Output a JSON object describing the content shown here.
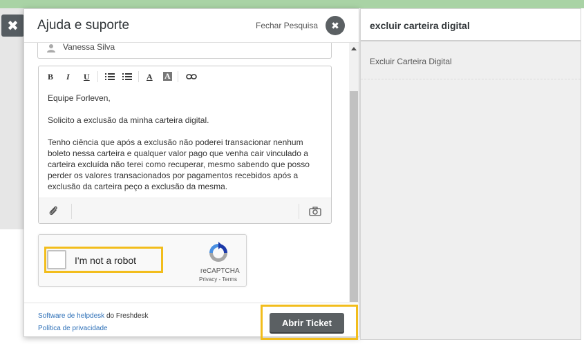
{
  "background": {
    "close_glyph": "✖"
  },
  "widget": {
    "title": "Ajuda e suporte",
    "close_search_label": "Fechar Pesquisa",
    "close_glyph": "✖"
  },
  "form": {
    "name_value": "Vanessa Silva",
    "toolbar": {
      "bold": "B",
      "italic": "I",
      "underline": "U",
      "font_color": "A",
      "bg_color": "A"
    },
    "message_paragraphs": [
      "Equipe Forleven,",
      "Solicito a exclusão da minha carteira digital.",
      "Tenho ciência que após a exclusão   não poderei transacionar nenhum boleto nessa carteira e qualquer valor pago que venha cair vinculado a carteira excluída não terei como recuperar, mesmo sabendo que posso perder os valores transacionados por pagamentos recebidos após a exclusão da carteira peço a exclusão da mesma."
    ]
  },
  "recaptcha": {
    "label": "I'm not a robot",
    "brand": "reCAPTCHA",
    "privacy": "Privacy",
    "separator": " - ",
    "terms": "Terms"
  },
  "footer": {
    "helpdesk_link": "Software de helpdesk",
    "helpdesk_suffix": " do Freshdesk",
    "privacy_link": "Política de privacidade",
    "submit_label": "Abrir Ticket"
  },
  "results": {
    "search_query": "excluir carteira digital",
    "items": [
      "Excluir Carteira Digital"
    ]
  },
  "colors": {
    "highlight": "#f2bd1c",
    "button": "#5b6063",
    "link": "#2c6fb7",
    "top_bar": "#a9d3a5"
  },
  "icons": [
    "close-icon",
    "person-icon",
    "bold-icon",
    "italic-icon",
    "underline-icon",
    "bullet-list-icon",
    "numbered-list-icon",
    "font-color-icon",
    "background-color-icon",
    "link-icon",
    "paperclip-icon",
    "camera-icon",
    "recaptcha-logo-icon"
  ]
}
